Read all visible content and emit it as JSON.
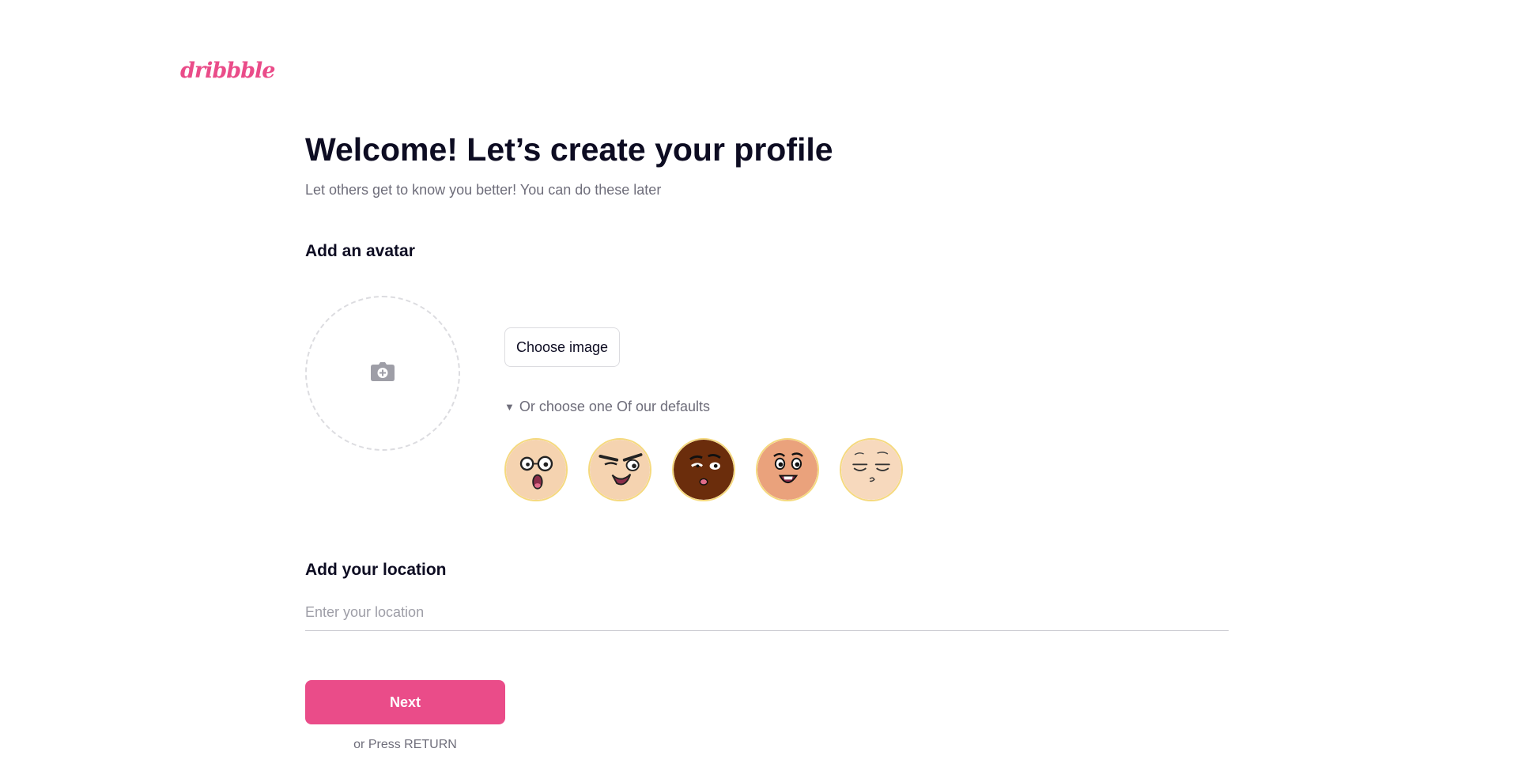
{
  "brand": {
    "logo_text": "dribbble",
    "accent_color": "#ea4c89"
  },
  "header": {
    "title": "Welcome! Let’s create your profile",
    "subtitle": "Let others get to know you better! You can do these later"
  },
  "avatar_section": {
    "label": "Add an avatar",
    "upload_icon": "camera-plus-icon",
    "choose_button_label": "Choose image",
    "defaults_toggle_label": "Or choose one Of our defaults",
    "defaults_toggle_icon": "triangle-down-icon",
    "default_avatars": [
      {
        "name": "glasses-face",
        "skin_color": "#f5d3b0"
      },
      {
        "name": "smirk-face",
        "skin_color": "#f5d3b0"
      },
      {
        "name": "worried-face",
        "skin_color": "#6b2d0c"
      },
      {
        "name": "happy-face",
        "skin_color": "#eaa27c"
      },
      {
        "name": "sleepy-face",
        "skin_color": "#f7d9bd"
      }
    ]
  },
  "location_section": {
    "label": "Add your location",
    "placeholder": "Enter your location",
    "value": ""
  },
  "actions": {
    "next_label": "Next",
    "return_hint": "or Press RETURN"
  }
}
